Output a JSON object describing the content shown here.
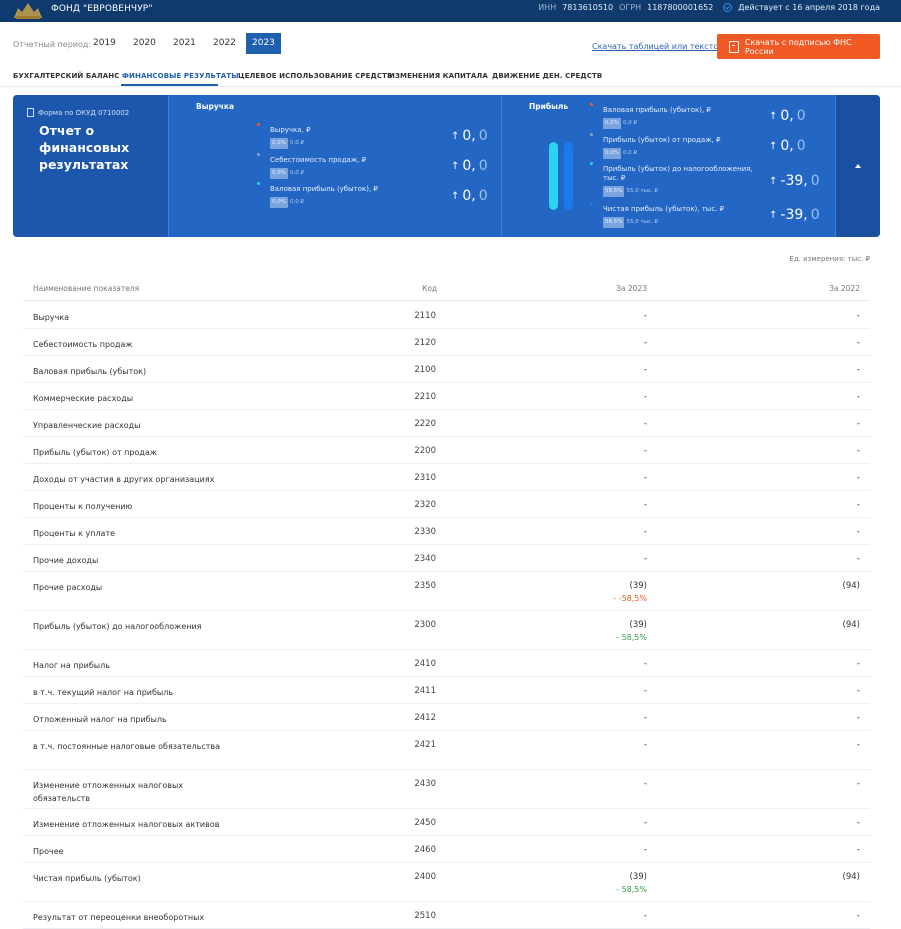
{
  "header": {
    "org_name": "ФОНД \"ЕВРОВЕНЧУР\"",
    "inn_label": "ИНН",
    "inn": "7813610510",
    "ogrn_label": "ОГРН",
    "ogrn": "1187800001652",
    "status": "Действует с 16 апреля 2018 года"
  },
  "period": {
    "label": "Отчетный период:",
    "years": [
      "2019",
      "2020",
      "2021",
      "2022",
      "2023"
    ],
    "active_year": "2023"
  },
  "download": {
    "text_link": "Скачать таблицей или текстом",
    "button": "Скачать с подписью ФНС России",
    "button_color": "#f15a24"
  },
  "tabs": [
    {
      "label": "БУХГАЛТЕРСКИЙ БАЛАНС",
      "active": false
    },
    {
      "label": "ФИНАНСОВЫЕ РЕЗУЛЬТАТЫ",
      "active": true
    },
    {
      "label": "ЦЕЛЕВОЕ ИСПОЛЬЗОВАНИЕ СРЕДСТВ",
      "active": false
    },
    {
      "label": "ИЗМЕНЕНИЯ КАПИТАЛА",
      "active": false
    },
    {
      "label": "ДВИЖЕНИЕ ДЕН. СРЕДСТВ",
      "active": false
    }
  ],
  "banner": {
    "form_code": "Форма по ОКУД 0710002",
    "title": "Отчет о финансовых результатах",
    "revenue_section": {
      "title": "Выручка",
      "metrics": [
        {
          "label": "Выручка, ₽",
          "pill": "0,0%",
          "sub": "0,0 ₽",
          "value_int": "0,",
          "value_frac": "0",
          "dot_color": "#f15a24"
        },
        {
          "label": "Себестоимость продаж, ₽",
          "pill": "0,0%",
          "sub": "0,0 ₽",
          "value_int": "0,",
          "value_frac": "0",
          "dot_color": "#8aa4c8"
        },
        {
          "label": "Валовая прибыль (убыток), ₽",
          "pill": "0,0%",
          "sub": "0,0 ₽",
          "value_int": "0,",
          "value_frac": "0",
          "dot_color": "#2bd3f0"
        }
      ]
    },
    "profit_section": {
      "title": "Прибыль",
      "metrics": [
        {
          "label": "Валовая прибыль (убыток), ₽",
          "pill": "0,0%",
          "sub": "0,0 ₽",
          "value_int": "0,",
          "value_frac": "0",
          "dot_color": "#f15a24"
        },
        {
          "label": "Прибыль (убыток) от продаж, ₽",
          "pill": "0,0%",
          "sub": "0,0 ₽",
          "value_int": "0,",
          "value_frac": "0",
          "dot_color": "#8aa4c8"
        },
        {
          "label": "Прибыль (убыток) до налогообложения, тыс. ₽",
          "pill": "58,5%",
          "sub": "55,0 тыс. ₽",
          "value_int": "-39,",
          "value_frac": "0",
          "dot_color": "#2bd3f0"
        },
        {
          "label": "Чистая прибыль (убыток), тыс. ₽",
          "pill": "58,5%",
          "sub": "55,0 тыс. ₽",
          "value_int": "-39,",
          "value_frac": "0",
          "dot_color": "#1e78f0"
        }
      ]
    }
  },
  "table": {
    "units": "Ед. измерения: тыс. ₽",
    "headers": {
      "name": "Наименование показателя",
      "code": "Код",
      "current": "За 2023",
      "previous": "За 2022"
    },
    "rows": [
      {
        "name": "Выручка",
        "code": "2110",
        "current": "-",
        "previous": "-",
        "delta": ""
      },
      {
        "name": "Себестоимость продаж",
        "code": "2120",
        "current": "-",
        "previous": "-",
        "delta": ""
      },
      {
        "name": "Валовая прибыль (убыток)",
        "code": "2100",
        "current": "-",
        "previous": "-",
        "delta": ""
      },
      {
        "name": "Коммерческие расходы",
        "code": "2210",
        "current": "-",
        "previous": "-",
        "delta": ""
      },
      {
        "name": "Управленческие расходы",
        "code": "2220",
        "current": "-",
        "previous": "-",
        "delta": ""
      },
      {
        "name": "Прибыль (убыток) от продаж",
        "code": "2200",
        "current": "-",
        "previous": "-",
        "delta": ""
      },
      {
        "name": "Доходы от участия в других организациях",
        "code": "2310",
        "current": "-",
        "previous": "-",
        "delta": ""
      },
      {
        "name": "Проценты к получению",
        "code": "2320",
        "current": "-",
        "previous": "-",
        "delta": ""
      },
      {
        "name": "Проценты к уплате",
        "code": "2330",
        "current": "-",
        "previous": "-",
        "delta": ""
      },
      {
        "name": "Прочие доходы",
        "code": "2340",
        "current": "-",
        "previous": "-",
        "delta": ""
      },
      {
        "name": "Прочие расходы",
        "code": "2350",
        "current": "(39)",
        "previous": "(94)",
        "delta": "- -58,5%",
        "delta_type": "neg"
      },
      {
        "name": "Прибыль (убыток) до налогообложения",
        "code": "2300",
        "current": "(39)",
        "previous": "(94)",
        "delta": "- 58,5%",
        "delta_type": "pos"
      },
      {
        "name": "Налог на прибыль",
        "code": "2410",
        "current": "-",
        "previous": "-",
        "delta": ""
      },
      {
        "name": "в т.ч. текущий налог на прибыль",
        "code": "2411",
        "current": "-",
        "previous": "-",
        "delta": ""
      },
      {
        "name": "Отложенный налог на прибыль",
        "code": "2412",
        "current": "-",
        "previous": "-",
        "delta": ""
      },
      {
        "name": "в т.ч. постоянные налоговые обязательства",
        "code": "2421",
        "current": "-",
        "previous": "-",
        "delta": ""
      },
      {
        "name": "Изменение отложенных налоговых обязательств",
        "code": "2430",
        "current": "-",
        "previous": "-",
        "delta": ""
      },
      {
        "name": "Изменение отложенных налоговых активов",
        "code": "2450",
        "current": "-",
        "previous": "-",
        "delta": ""
      },
      {
        "name": "Прочее",
        "code": "2460",
        "current": "-",
        "previous": "-",
        "delta": ""
      },
      {
        "name": "Чистая прибыль (убыток)",
        "code": "2400",
        "current": "(39)",
        "previous": "(94)",
        "delta": "- 58,5%",
        "delta_type": "pos"
      },
      {
        "name": "Результат от переоценки внеоборотных",
        "code": "2510",
        "current": "-",
        "previous": "-",
        "delta": ""
      }
    ]
  }
}
